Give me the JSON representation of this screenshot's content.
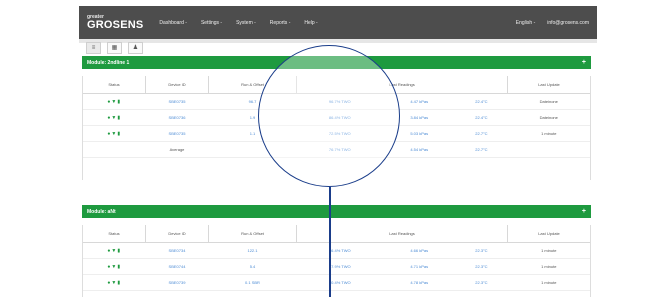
{
  "header": {
    "logo_sup": "greater",
    "logo_main": "GROSENS",
    "nav": [
      "Dashboard -",
      "Settings -",
      "System -",
      "Reports -",
      "Help -"
    ],
    "right": [
      "English -",
      "info@grosens.com"
    ]
  },
  "toggles": [
    "≡",
    "▦",
    "♟"
  ],
  "sections": [
    {
      "title": "Module: 2ndline 1",
      "headers": [
        "Status",
        "Device ID",
        "Run & Offset",
        "Last Readings",
        "Last Update"
      ],
      "rows": [
        {
          "status": "●▼▮",
          "device": "SBE0735",
          "run": "96.7",
          "r1": "96.7% TWO",
          "r2": "4.47 kPas",
          "r3": "22.4°C",
          "update": "Dateinone"
        },
        {
          "status": "●▼▮",
          "device": "SBE0736",
          "run": "1.9",
          "r1": "86.4% TWO",
          "r2": "3.84 kPas",
          "r3": "22.4°C",
          "update": "Dateinone"
        },
        {
          "status": "●▼▮",
          "device": "SBE0735",
          "run": "1.1",
          "r1": "72.5% TWO",
          "r2": "5.03 kPas",
          "r3": "22.7°C",
          "update": "1 minute"
        },
        {
          "status": "",
          "device": "Average",
          "run": "",
          "r1": "76.7% TWO",
          "r2": "4.54 kPas",
          "r3": "22.7°C",
          "update": ""
        }
      ]
    },
    {
      "title": "Module: aNt",
      "headers": [
        "Status",
        "Device ID",
        "Run & Offset",
        "Last Readings",
        "Last Update"
      ],
      "rows": [
        {
          "status": "●▼▮",
          "device": "SBE0734",
          "run": "122.1",
          "r1": "86.4% TWO",
          "r2": "4.66 kPas",
          "r3": "22.3°C",
          "update": "1 minute"
        },
        {
          "status": "●▼▮",
          "device": "SBE0744",
          "run": "5.4",
          "r1": "77.9% TWO",
          "r2": "4.71 kPas",
          "r3": "22.3°C",
          "update": "1 minute"
        },
        {
          "status": "●▼▮",
          "device": "SBE0739",
          "run": "0.1 SBR",
          "r1": "80.4% TWO",
          "r2": "4.78 kPas",
          "r3": "22.3°C",
          "update": "1 minute"
        }
      ]
    }
  ],
  "colors": {
    "accent": "#1e9a3f",
    "nav": "#4d4d4d",
    "link": "#4a8ad4",
    "magnifier": "#1a3d8a"
  }
}
